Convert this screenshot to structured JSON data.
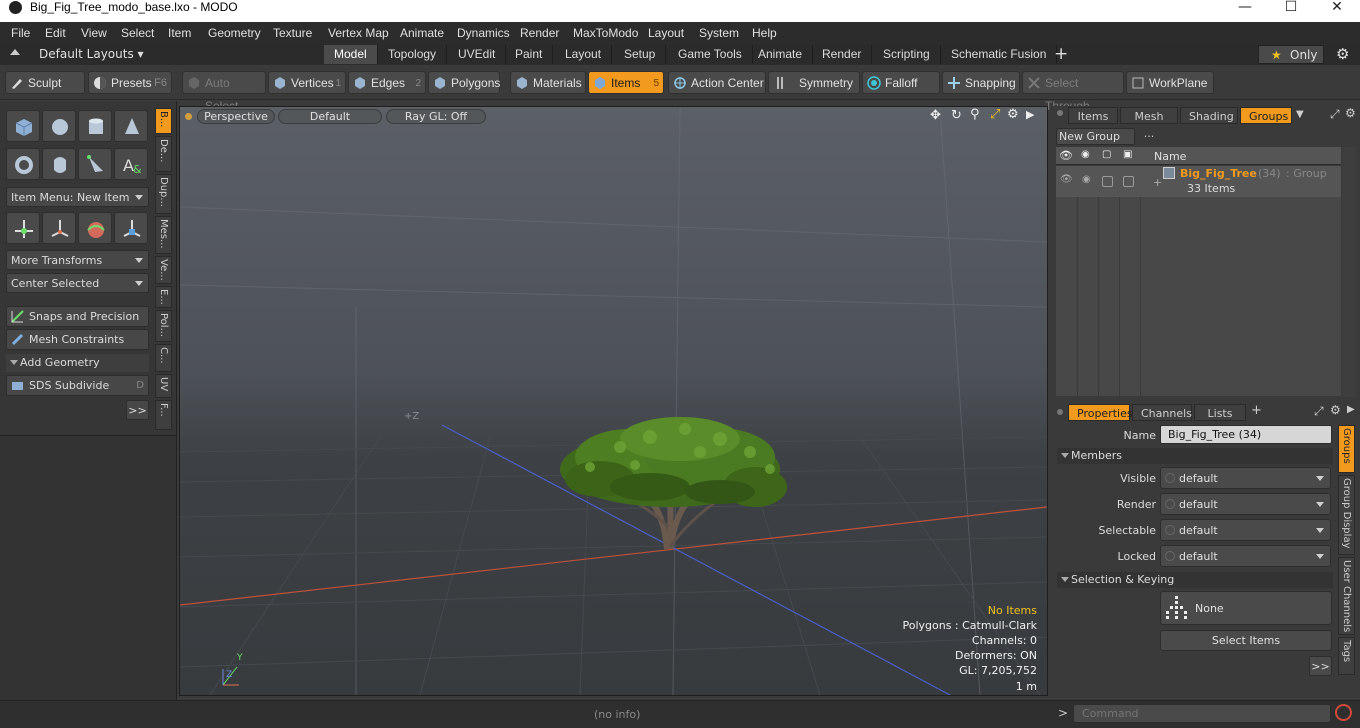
{
  "window": {
    "title": "Big_Fig_Tree_modo_base.lxo - MODO"
  },
  "menu": [
    "File",
    "Edit",
    "View",
    "Select",
    "Item",
    "Geometry",
    "Texture",
    "Vertex Map",
    "Animate",
    "Dynamics",
    "Render",
    "MaxToModo",
    "Layout",
    "System",
    "Help"
  ],
  "layouts": {
    "label": "Default Layouts"
  },
  "tabs": [
    "Model",
    "Topology",
    "UVEdit",
    "Paint",
    "Layout",
    "Setup",
    "Game Tools",
    "Animate",
    "Render",
    "Scripting",
    "Schematic Fusion"
  ],
  "tabs_active": "Model",
  "only_label": "Only",
  "toolbar": {
    "sculpt": "Sculpt",
    "presets": "Presets",
    "presets_key": "F6",
    "auto_select": "Auto Select",
    "vertices": "Vertices",
    "vertices_num": "1",
    "edges": "Edges",
    "edges_num": "2",
    "polygons": "Polygons",
    "materials": "Materials",
    "items": "Items",
    "items_num": "5",
    "action_center": "Action Center",
    "symmetry": "Symmetry",
    "falloff": "Falloff",
    "snapping": "Snapping",
    "select_through": "Select Through",
    "workplane": "WorkPlane"
  },
  "left": {
    "item_menu": "Item Menu: New Item",
    "more_transforms": "More Transforms",
    "center_selected": "Center Selected",
    "snaps": "Snaps and Precision",
    "mesh_constraints": "Mesh Constraints",
    "add_geometry": "Add Geometry",
    "sds_subdivide": "SDS Subdivide",
    "sds_key": "D",
    "more": ">>",
    "vtabs": [
      "B...",
      "De...",
      "Dup...",
      "Mes...",
      "Ve...",
      "E...",
      "Pol...",
      "C...",
      "UV",
      "F..."
    ]
  },
  "viewport": {
    "perspective": "Perspective",
    "default": "Default",
    "raygl": "Ray GL: Off",
    "axis_label": "+Z",
    "info": {
      "items": "No Items",
      "polygons": "Polygons : Catmull-Clark",
      "channels": "Channels: 0",
      "deformers": "Deformers: ON",
      "gl": "GL: 7,205,752",
      "scale": "1 m"
    },
    "axes": {
      "y": "Y",
      "z": "Z"
    }
  },
  "groups_panel": {
    "tabs": [
      "Items",
      "Mesh ...",
      "Shading",
      "Groups"
    ],
    "active_tab": "Groups",
    "new_group": "New Group",
    "col_name": "Name",
    "row": {
      "name": "Big_Fig_Tree",
      "count": "(34)",
      "type": ": Group",
      "items": "33 Items"
    }
  },
  "properties": {
    "tabs": [
      "Properties",
      "Channels",
      "Lists"
    ],
    "active_tab": "Properties",
    "name_label": "Name",
    "name_value": "Big_Fig_Tree (34)",
    "members": "Members",
    "visible": "Visible",
    "render": "Render",
    "selectable": "Selectable",
    "locked": "Locked",
    "default": "default",
    "selection_keying": "Selection & Keying",
    "none": "None",
    "select_items": "Select Items",
    "more": ">>",
    "vtabs": [
      "Groups",
      "Group Display",
      "User Channels",
      "Tags"
    ]
  },
  "status": {
    "info": "(no info)",
    "command_placeholder": "Command"
  },
  "colors": {
    "accent": "#f29a1e",
    "bg": "#3a3a3a",
    "grid_x": "#c0503a",
    "grid_z": "#4a5ec8"
  }
}
